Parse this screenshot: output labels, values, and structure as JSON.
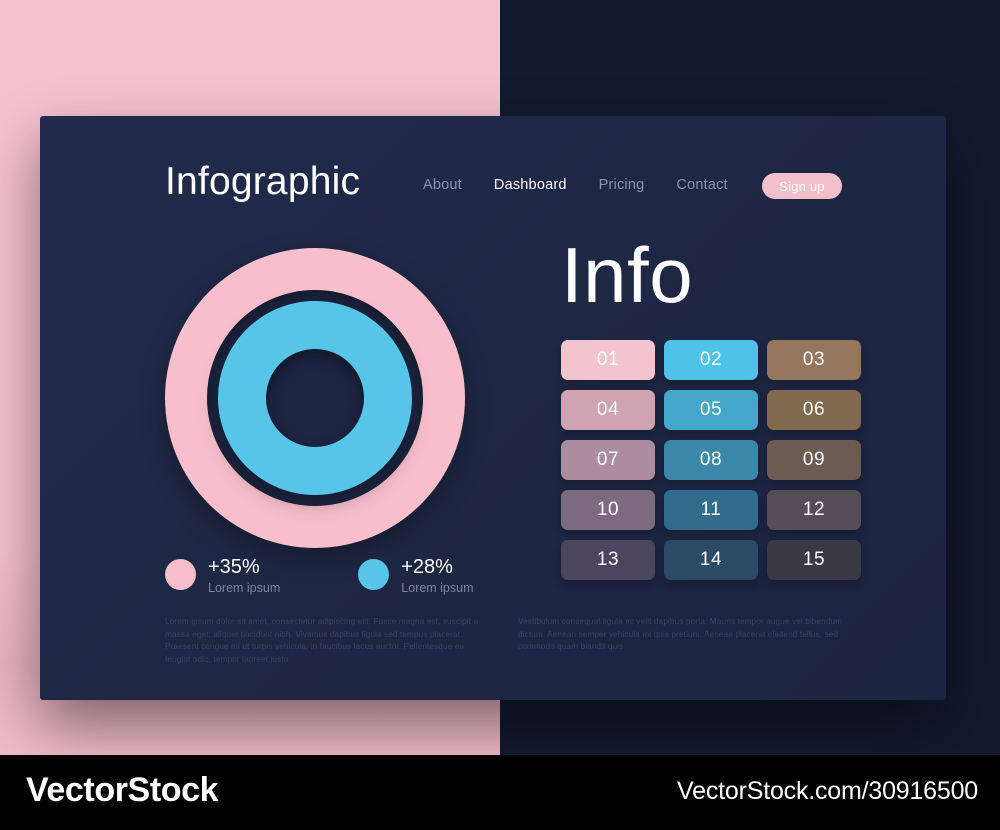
{
  "nav": {
    "brand": "Infographic",
    "links": [
      {
        "label": "About",
        "active": false
      },
      {
        "label": "Dashboard",
        "active": true
      },
      {
        "label": "Pricing",
        "active": false
      },
      {
        "label": "Contact",
        "active": false
      }
    ],
    "signup_label": "Sign up"
  },
  "left_panel": {
    "legend": [
      {
        "value": "+35%",
        "caption": "Lorem ipsum",
        "color": "#f7bfcb"
      },
      {
        "value": "+28%",
        "caption": "Lorem ipsum",
        "color": "#57c5e8"
      }
    ],
    "paragraph": "Lorem ipsum dolor sit amet, consectetur adipiscing elit. Fusce magna est, suscipit a massa eget, aliquet tincidunt nibh. Vivamus dapibus ligula sed tempus placerat. Praesent congue mi ut turpis vehicula, in faucibus lacus auctor. Pellentesque eu feugiat odio, tempor laoreet justo"
  },
  "right_panel": {
    "title": "Info",
    "paragraph": "Vestibulum consequat ligula ac velit dapibus porta. Mauris tempor augue vel bibendum dictum. Aenean semper vehicula mi quis pretium. Aenean placerat eleifend tellus, sed commodo quam blandit quis",
    "tiles": [
      {
        "label": "01",
        "color": "#f3c3ce"
      },
      {
        "label": "02",
        "color": "#4ec3e8"
      },
      {
        "label": "03",
        "color": "#93765c"
      },
      {
        "label": "04",
        "color": "#cfa3b2"
      },
      {
        "label": "05",
        "color": "#45a6cc"
      },
      {
        "label": "06",
        "color": "#80694f"
      },
      {
        "label": "07",
        "color": "#ad8d9d"
      },
      {
        "label": "08",
        "color": "#3a87a9"
      },
      {
        "label": "09",
        "color": "#6b5b52"
      },
      {
        "label": "10",
        "color": "#7c6b7f"
      },
      {
        "label": "11",
        "color": "#336b8d"
      },
      {
        "label": "12",
        "color": "#544e55"
      },
      {
        "label": "13",
        "color": "#4b4560"
      },
      {
        "label": "14",
        "color": "#294b68"
      },
      {
        "label": "15",
        "color": "#3a3844"
      }
    ]
  },
  "theme": {
    "card_background": "#1e2744",
    "page_background": "#121a2f",
    "accent_pink": "#f6c2cd",
    "accent_blue": "#57c5e8"
  },
  "chart_data": {
    "type": "pie",
    "title": "",
    "categories": [
      "Lorem ipsum",
      "Lorem ipsum"
    ],
    "values": [
      35,
      28
    ],
    "value_labels": [
      "+35%",
      "+28%"
    ],
    "colors": [
      "#f7bfcb",
      "#57c5e8"
    ],
    "legend_position": "bottom",
    "grid": false
  },
  "watermark": {
    "logo": "VectorStock",
    "url": "VectorStock.com/30916500"
  }
}
